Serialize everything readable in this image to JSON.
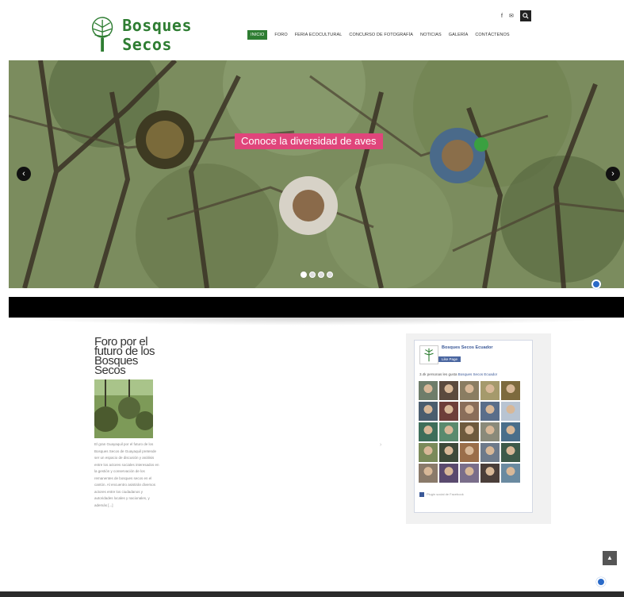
{
  "brand": {
    "name": "Bosques Secos"
  },
  "nav": {
    "items": [
      "INICIO",
      "FORO",
      "FERIA ECOCULTURAL",
      "CONCURSO DE FOTOGRAFÍA",
      "NOTICIAS",
      "GALERÍA",
      "CONTÁCTENOS"
    ],
    "active_index": 0
  },
  "social": {
    "facebook_icon": "f",
    "email_icon": "✉",
    "search_icon": "search-icon"
  },
  "slider": {
    "caption": "Conoce la diversidad de aves",
    "prev_icon": "‹",
    "next_icon": "›",
    "slide_count": 4,
    "active_slide": 0
  },
  "post": {
    "title": "Foro por el futuro de los Bosques Secos",
    "excerpt": "El gran Guayaquil por el futuro de los Bosques Secos de Guayaquil pretende ser un espacio de discusión y análisis entre los actores sociales interesados en la gestión y conservación de los remanentes de bosques secos en el cantón. Al encuentro asistirán diversos actores entre los ciudadanos y autoridades locales y nacionales, y además [...]"
  },
  "facebook_widget": {
    "page_name": "Bosques Secos Ecuador",
    "like_label": "Like Page",
    "likes_text": "3.4k personas les gusta",
    "likes_link": "Bosques Secos Ecuador",
    "footer": "Plugin social de Facebook",
    "faces": [
      "#6e7d6a",
      "#5b4a3e",
      "#8a7d62",
      "#a59a6c",
      "#7d6a3e",
      "#4a5d6e",
      "#6e3e3a",
      "#8a6e5a",
      "#5a6e8a",
      "#b8c4d2",
      "#3e6e5a",
      "#5a8a6e",
      "#6e5a3e",
      "#8a8a7a",
      "#4a6e8a",
      "#7a8a5a",
      "#3e4a3a",
      "#9a6e4a",
      "#6e7a8a",
      "#3e5a4a",
      "#8a7a6a",
      "#5a4a6e",
      "#7a6e8a",
      "#4a3e3a",
      "#6a8aa0"
    ]
  },
  "back_to_top": "▲"
}
